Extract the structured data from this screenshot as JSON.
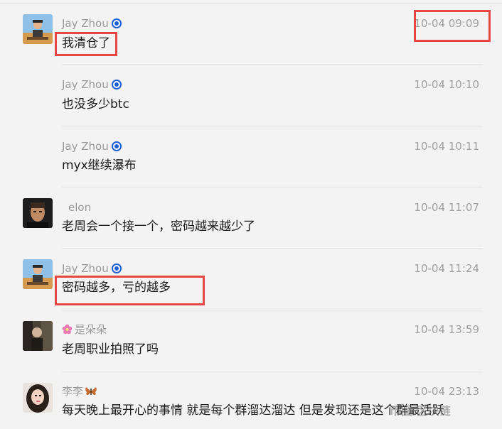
{
  "messages": [
    {
      "name": "Jay Zhou",
      "time": "10-04 09:09",
      "text": "我清仓了"
    },
    {
      "name": "Jay Zhou",
      "time": "10-04 10:10",
      "text": "也没多少btc"
    },
    {
      "name": "Jay Zhou",
      "time": "10-04 10:11",
      "text": "myx继续瀑布"
    },
    {
      "name": "elon",
      "time": "10-04 11:07",
      "text": "老周会一个接一个，密码越来越少了"
    },
    {
      "name": "Jay Zhou",
      "time": "10-04 11:24",
      "text": "密码越多，亏的越多"
    },
    {
      "name": "是朵朵",
      "time": "10-04 13:59",
      "text": "老周职业拍照了吗"
    },
    {
      "name": "李李",
      "time": "10-04 23:13",
      "text": "每天晚上最开心的事情 就是每个群溜达溜达 但是发现还是这个群最活跃"
    }
  ],
  "watermark": "币圈 区块链",
  "colors": {
    "background": "#f3f3f3",
    "highlight_box": "#e84545",
    "verified_badge": "#1d5fd1",
    "meta_text": "#9a9a9a",
    "message_text": "#1a1a1a"
  },
  "icons": {
    "verified": "verified-badge-icon",
    "flower": "flower-icon",
    "butterfly": "butterfly-icon"
  }
}
